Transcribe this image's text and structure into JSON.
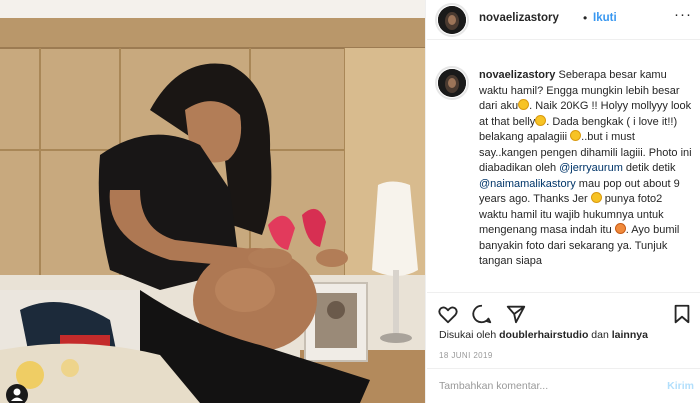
{
  "header": {
    "username": "novaelizastory",
    "separator": "•",
    "follow_label": "Ikuti",
    "more_label": "···",
    "avatar_icon": "profile-avatar-icon"
  },
  "caption": {
    "username": "novaelizastory",
    "part1": " Seberapa besar kamu waktu hamil? Engga mungkin lebih besar dari aku",
    "part2": ". Naik 20KG !! Holyy mollyyy look at that belly",
    "part3": ". Dada bengkak ( i love it!!) belakang apalagiii ",
    "part4": "..but i must say..kangen pengen dihamili lagiii. Photo ini diabadikan oleh ",
    "mention1": "@jerryaurum",
    "part5": " detik detik ",
    "mention2": "@naimamalikastory",
    "part6": " mau pop out about 9 years ago. Thanks Jer ",
    "part7": " punya foto2 waktu hamil itu wajib hukumnya untuk mengenang masa indah itu ",
    "part8": ". Ayo bumil banyakin foto dari sekarang ya. Tunjuk tangan siapa"
  },
  "actions": {
    "like_icon": "heart-icon",
    "comment_icon": "comment-icon",
    "share_icon": "share-icon",
    "save_icon": "bookmark-icon"
  },
  "likes": {
    "prefix": "Disukai oleh ",
    "user": "doublerhairstudio",
    "middle": " dan ",
    "others": "lainnya"
  },
  "date": "18 JUNI 2019",
  "comment_box": {
    "placeholder": "Tambahkan komentar...",
    "send_label": "Kirim"
  },
  "colors": {
    "link_blue": "#3897f0",
    "mention_blue": "#003569",
    "muted_gray": "#999999",
    "disabled_send": "#b2dffc"
  }
}
